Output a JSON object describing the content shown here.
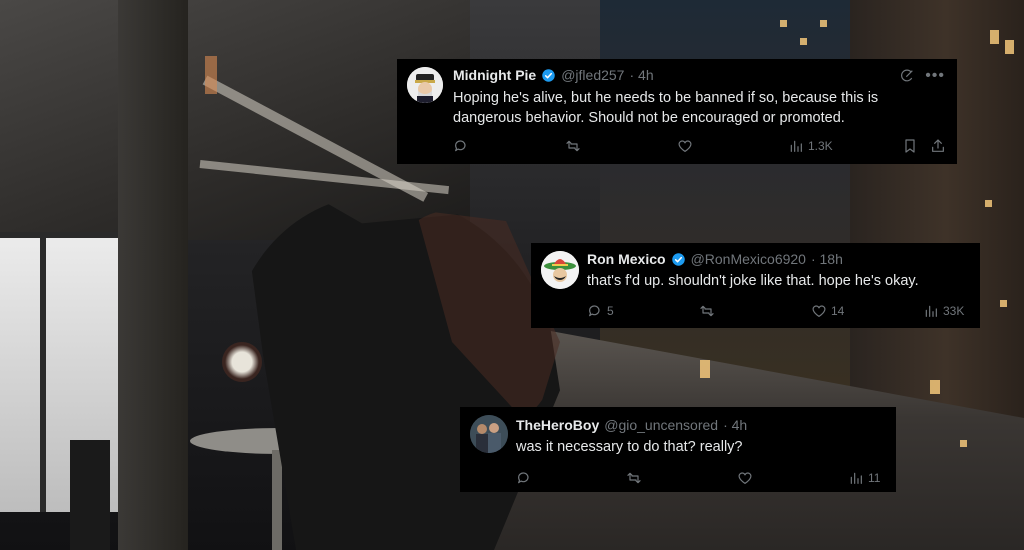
{
  "tweets": [
    {
      "name": "Midnight Pie",
      "handle": "@jfled257",
      "time": "· 4h",
      "verified": true,
      "text_line1": "Hoping he's alive, but he needs to be banned if so, because this is",
      "text_line2": "dangerous behavior. Should not be encouraged or promoted.",
      "reply_count": "",
      "retweet_count": "",
      "like_count": "",
      "view_count": "1.3K",
      "avatar_icon": "captain-avatar"
    },
    {
      "name": "Ron Mexico",
      "handle": "@RonMexico6920",
      "time": "· 18h",
      "verified": true,
      "text_line1": "that's f'd up. shouldn't joke like that. hope he's okay.",
      "reply_count": "5",
      "retweet_count": "",
      "like_count": "14",
      "view_count": "33K",
      "avatar_icon": "sombrero-avatar"
    },
    {
      "name": "TheHeroBoy",
      "handle": "@gio_uncensored",
      "time": "· 4h",
      "verified": false,
      "text_line1": "was it necessary to do that? really?",
      "reply_count": "",
      "retweet_count": "",
      "like_count": "",
      "view_count": "11",
      "avatar_icon": "group-photo-avatar"
    }
  ],
  "colors": {
    "card_bg": "#000000",
    "name": "#e7e9ea",
    "muted": "#71767b",
    "verified": "#1d9bf0"
  }
}
